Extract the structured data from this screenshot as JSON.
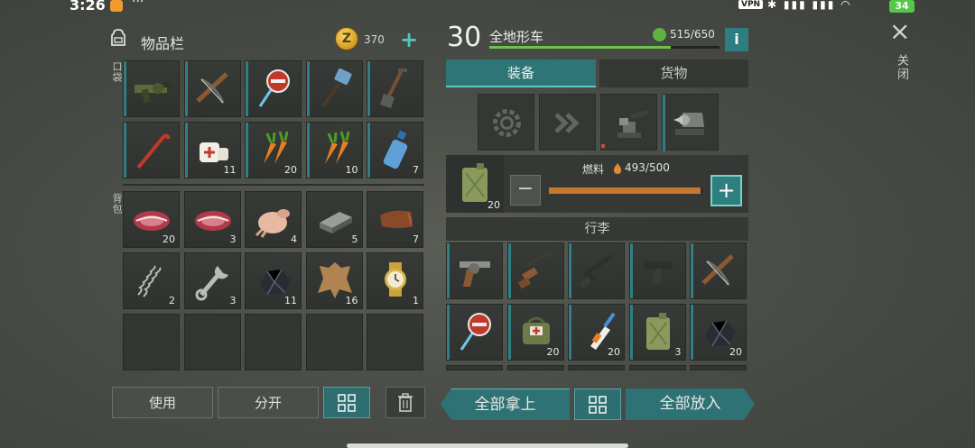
{
  "status_bar": {
    "time": "3:26",
    "dots": "···",
    "vpn": "VPN",
    "battery": "34"
  },
  "inventory": {
    "title": "物品栏",
    "coin_icon": "Z",
    "coins": "370",
    "add": "+",
    "pocket_label": "口袋",
    "backpack_label": "背包",
    "use": "使用",
    "split": "分开",
    "pocket_items": [
      {
        "icon": "grenade-launcher",
        "count": ""
      },
      {
        "icon": "crossbow",
        "count": ""
      },
      {
        "icon": "stop-sign",
        "count": ""
      },
      {
        "icon": "sledgehammer",
        "count": ""
      },
      {
        "icon": "shovel",
        "count": ""
      },
      {
        "icon": "crowbar",
        "count": ""
      },
      {
        "icon": "bandage",
        "count": "11"
      },
      {
        "icon": "carrots",
        "count": "20"
      },
      {
        "icon": "carrots",
        "count": "10"
      },
      {
        "icon": "water-bottle",
        "count": "7"
      }
    ],
    "backpack_items": [
      {
        "icon": "raw-meat",
        "count": "20"
      },
      {
        "icon": "raw-meat",
        "count": "3"
      },
      {
        "icon": "raw-chicken",
        "count": "4"
      },
      {
        "icon": "iron-bar",
        "count": "5"
      },
      {
        "icon": "leather",
        "count": "7"
      },
      {
        "icon": "spring",
        "count": "2"
      },
      {
        "icon": "wrench",
        "count": "3"
      },
      {
        "icon": "coal-ore",
        "count": "11"
      },
      {
        "icon": "animal-hide",
        "count": "16"
      },
      {
        "icon": "gold-watch",
        "count": "1"
      }
    ]
  },
  "vehicle": {
    "level": "30",
    "name": "全地形车",
    "capacity": "515/650",
    "capacity_fraction": 0.79,
    "info": "i",
    "tab_equipment": "装备",
    "tab_cargo": "货物",
    "fuel_label": "燃料",
    "fuel_value": "493/500",
    "fuel_fraction": 0.986,
    "fuel_can_count": "20",
    "minus": "−",
    "plus": "+",
    "luggage_label": "行李",
    "take_all": "全部拿上",
    "put_all": "全部放入",
    "cargo_items": [
      {
        "icon": "revolver",
        "count": ""
      },
      {
        "icon": "shotgun",
        "count": ""
      },
      {
        "icon": "assault-rifle",
        "count": ""
      },
      {
        "icon": "pistol",
        "count": ""
      },
      {
        "icon": "crossbow",
        "count": ""
      },
      {
        "icon": "stop-sign",
        "count": ""
      },
      {
        "icon": "medkit-bag",
        "count": "20"
      },
      {
        "icon": "glue-bottle",
        "count": "20"
      },
      {
        "icon": "jerrycan",
        "count": "3"
      },
      {
        "icon": "coal-ore",
        "count": "20"
      }
    ]
  },
  "close_label": "关闭",
  "close_icon": "×"
}
